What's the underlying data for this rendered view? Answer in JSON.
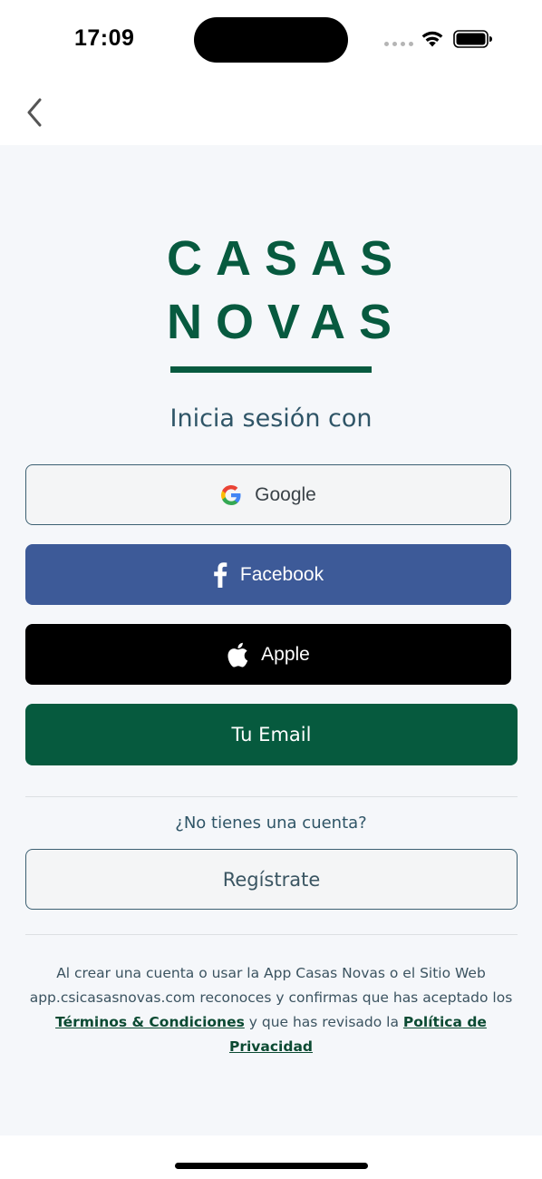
{
  "status_bar": {
    "time": "17:09"
  },
  "logo": {
    "line1": "CASAS",
    "line2": "NOVAS"
  },
  "login": {
    "heading": "Inicia sesión con",
    "google_label": "Google",
    "facebook_label": "Facebook",
    "apple_label": "Apple",
    "email_label": "Tu Email"
  },
  "signup": {
    "prompt": "¿No tienes una cuenta?",
    "register_label": "Regístrate"
  },
  "legal": {
    "text_before": "Al crear una cuenta o usar la App Casas Novas o el Sitio Web app.csicasasnovas.com reconoces y confirmas que has aceptado los",
    "terms_link": "Términos & Condiciones",
    "text_middle": "y que has revisado la",
    "privacy_link": "Política de Privacidad"
  },
  "colors": {
    "brand_green": "#075a3f",
    "facebook_blue": "#3d5a98",
    "apple_black": "#000000",
    "background": "#f5f7fa"
  },
  "icons": {
    "back": "chevron-left-icon",
    "google": "google-g-icon",
    "facebook": "facebook-f-icon",
    "apple": "apple-logo-icon"
  }
}
